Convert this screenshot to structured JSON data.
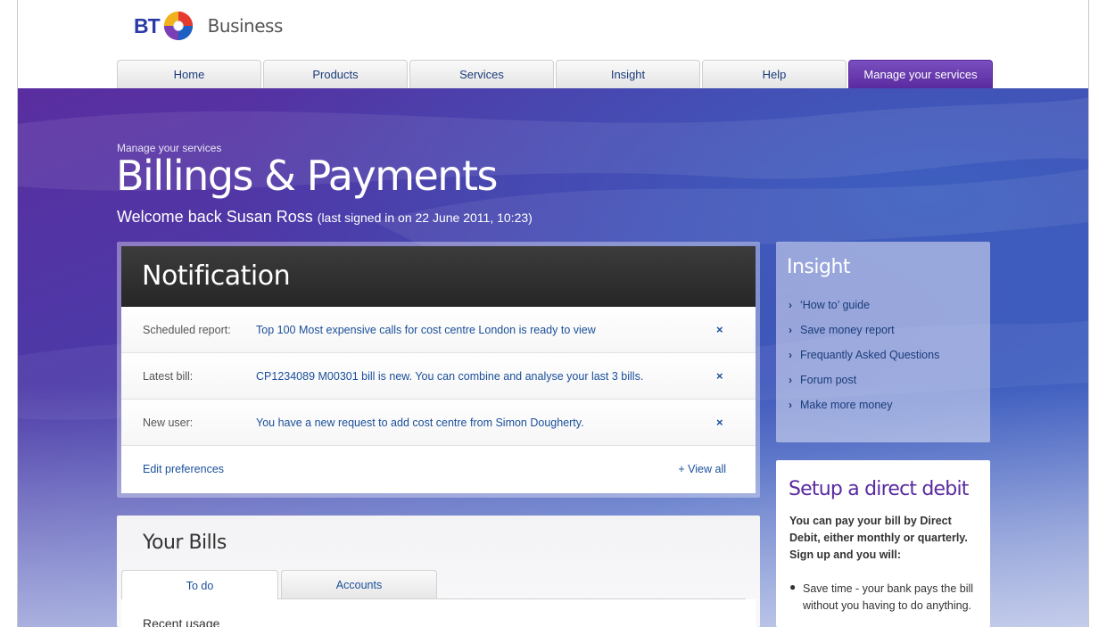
{
  "header": {
    "logo_text": "BT",
    "brand_suffix": "Business"
  },
  "nav": {
    "tabs": [
      {
        "label": "Home",
        "active": false
      },
      {
        "label": "Products",
        "active": false
      },
      {
        "label": "Services",
        "active": false
      },
      {
        "label": "Insight",
        "active": false
      },
      {
        "label": "Help",
        "active": false
      },
      {
        "label": "Manage your services",
        "active": true
      }
    ]
  },
  "hero": {
    "breadcrumb": "Manage your services",
    "title": "Billings & Payments",
    "welcome": "Welcome back Susan Ross",
    "last_signed_in": "(last signed in on 22 June 2011, 10:23)"
  },
  "notification": {
    "title": "Notification",
    "rows": [
      {
        "label": "Scheduled report:",
        "text": "Top 100 Most expensive calls for cost centre London is ready to view",
        "close": "×"
      },
      {
        "label": "Latest bill:",
        "text": "CP1234089 M00301 bill is new. You can combine and analyse your last 3 bills.",
        "close": "×"
      },
      {
        "label": "New user:",
        "text": "You have a new request to add cost centre from Simon Dougherty.",
        "close": "×"
      }
    ],
    "edit_preferences": "Edit preferences",
    "view_all": "+ View all"
  },
  "bills": {
    "title": "Your Bills",
    "tabs": [
      "To do",
      "Accounts"
    ],
    "section": "Recent usage"
  },
  "insight": {
    "title": "Insight",
    "items": [
      "‘How to’ guide",
      "Save money report",
      "Frequantly Asked Questions",
      "Forum post",
      "Make more money"
    ]
  },
  "direct_debit": {
    "title": "Setup a direct debit",
    "intro": "You can pay your bill by Direct Debit, either monthly or quarterly. Sign up and you will:",
    "bullet": "Save time - your bank pays the bill without you having to do anything."
  },
  "colors": {
    "brand_purple": "#5a2aa0",
    "link_blue": "#1a4f9a",
    "hero_blue": "#3e5cbf"
  }
}
